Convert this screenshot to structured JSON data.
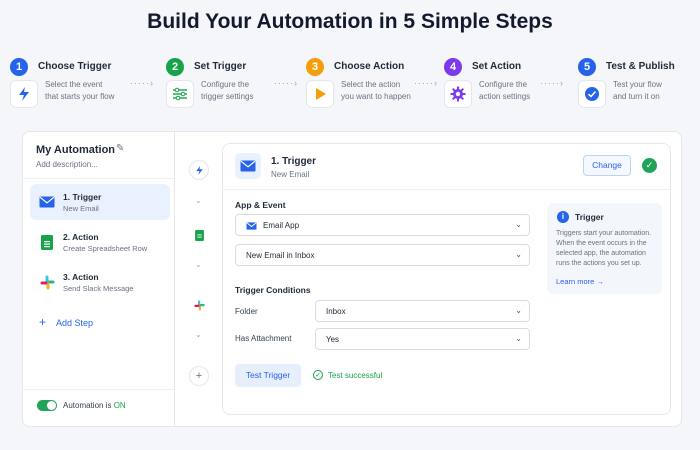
{
  "page_title": "Build Your Automation in 5 Simple Steps",
  "steps": [
    {
      "num": "1",
      "title": "Choose Trigger",
      "desc1": "Select the event",
      "desc2": "that starts your flow",
      "icon": "bolt-icon",
      "color": "#2563eb"
    },
    {
      "num": "2",
      "title": "Set Trigger",
      "desc1": "Configure the",
      "desc2": "trigger settings",
      "icon": "sliders-icon",
      "color": "#16a34a"
    },
    {
      "num": "3",
      "title": "Choose Action",
      "desc1": "Select the action",
      "desc2": "you want to happen",
      "icon": "play-icon",
      "color": "#f59e0b"
    },
    {
      "num": "4",
      "title": "Set Action",
      "desc1": "Configure the",
      "desc2": "action settings",
      "icon": "gear-icon",
      "color": "#7c3aed"
    },
    {
      "num": "5",
      "title": "Test & Publish",
      "desc1": "Test your flow",
      "desc2": "and turn it on",
      "icon": "check-circle-icon",
      "color": "#2563eb"
    }
  ],
  "sidebar": {
    "title": "My Automation",
    "description": "Add description...",
    "items": [
      {
        "title": "1. Trigger",
        "subtitle": "New Email",
        "icon": "mail-icon"
      },
      {
        "title": "2. Action",
        "subtitle": "Create Spreadsheet Row",
        "icon": "sheets-icon"
      },
      {
        "title": "3. Action",
        "subtitle": "Send Slack Message",
        "icon": "slack-icon"
      }
    ],
    "add_step": "Add Step",
    "toggle_prefix": "Automation is ",
    "toggle_state": "ON"
  },
  "detail": {
    "title": "1. Trigger",
    "subtitle": "New Email",
    "change_label": "Change",
    "app_event_label": "App & Event",
    "app_value": "Email App",
    "event_value": "New Email in Inbox",
    "conditions_label": "Trigger Conditions",
    "conditions": [
      {
        "label": "Folder",
        "value": "Inbox"
      },
      {
        "label": "Has Attachment",
        "value": "Yes"
      }
    ],
    "test_button": "Test Trigger",
    "test_status": "Test successful"
  },
  "info": {
    "title": "Trigger",
    "body": "Triggers start your automation. When the event occurs in the selected app, the automation runs the actions you set up.",
    "link": "Learn more →"
  },
  "colors": {
    "accent": "#2563eb",
    "success": "#16a34a"
  }
}
